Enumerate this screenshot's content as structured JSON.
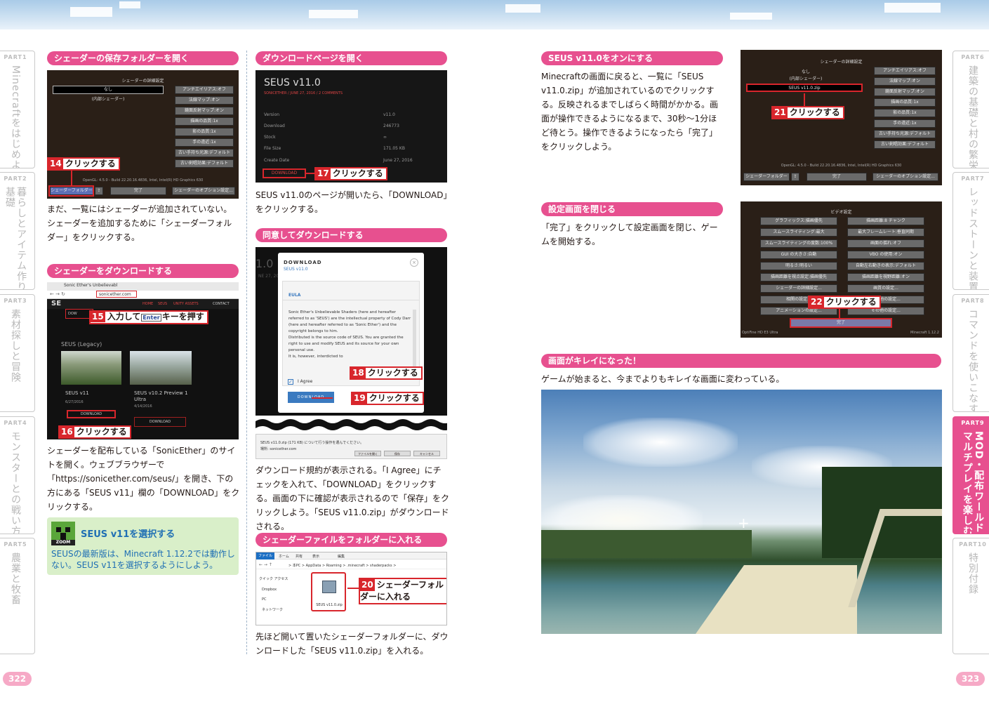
{
  "page_left": {
    "number": "322"
  },
  "page_right": {
    "number": "323"
  },
  "side_left": [
    {
      "part": "PART1",
      "title": "Minecraftをはじめよう"
    },
    {
      "part": "PART2",
      "title": "暮らしとアイテム作りの\n基礎"
    },
    {
      "part": "PART3",
      "title": "素材探しと冒険"
    },
    {
      "part": "PART4",
      "title": "モンスターとの戦い方"
    },
    {
      "part": "PART5",
      "title": "農業と牧畜"
    }
  ],
  "side_right": [
    {
      "part": "PART6",
      "title": "建築の基礎と村の繁栄"
    },
    {
      "part": "PART7",
      "title": "レッドストーンと装置"
    },
    {
      "part": "PART8",
      "title": "コマンドを使いこなす"
    },
    {
      "part": "PART9",
      "title": "MOD・配布ワールド・\nマルチプレイを楽しむ"
    },
    {
      "part": "PART10",
      "title": "特別付録"
    }
  ],
  "sec_open_folder": {
    "heading": "シェーダーの保存フォルダーを開く",
    "text": "まだ、一覧にはシェーダーが追加されていない。シェーダーを追加するために「シェーダーフォルダー」をクリックする。",
    "callout": {
      "num": "14",
      "label": "クリックする"
    },
    "mc": {
      "title": "シェーダーの詳細設定",
      "none": "なし",
      "internal": "(内部シェーダー)",
      "version": "OpenGL: 4.5.0 - Build 22.20.16.4836, Intel, Intel(R) HD Graphics 630",
      "btn_folder": "シェーダーフォルダー",
      "btn_done": "完了",
      "btn_options": "シェーダーのオプション設定...",
      "opts": [
        "アンチエイリアス:オフ",
        "法線マップ:オン",
        "鏡面反射マップ:オン",
        "描画の品質:1x",
        "影の品質:1x",
        "手の遠近:1x",
        "古い手持ち光源:デフォルト",
        "古い剣唱効果:デフォルト"
      ]
    }
  },
  "sec_download_seus": {
    "heading": "シェーダーをダウンロードする",
    "text": "シェーダーを配布している「SonicEther」のサイトを開く。ウェブブラウザーで「https://sonicether.com/seus/」を開き、下の方にある「SEUS v11」欄の「DOWNLOAD」をクリックする。",
    "callout15": {
      "num": "15",
      "pre": "入力して",
      "key": "Enter",
      "post": "キーを押す"
    },
    "callout16": {
      "num": "16",
      "label": "クリックする"
    },
    "browser": {
      "tab": "Sonic Ether's Unbelievabl",
      "url": "sonicether.com",
      "nav": [
        "HOME",
        "SEUS",
        "UNITY ASSETS",
        "CONTACT"
      ],
      "legacy": "SEUS (Legacy)",
      "card1_title": "SEUS v11",
      "card1_date": "6/27/2016",
      "card2_title": "SEUS v10.2 Preview 1 Ultra",
      "card2_date": "4/14/2016",
      "download": "DOWNLOAD"
    }
  },
  "zoom": {
    "badge": "ZOOM",
    "title": "SEUS v11を選択する",
    "text": "SEUSの最新版は、Minecraft 1.12.2では動作しない。SEUS v11を選択するようにしよう。"
  },
  "sec_open_page": {
    "heading": "ダウンロードページを開く",
    "text": "SEUS v11.0のページが開いたら、「DOWNLOAD」をクリックする。",
    "callout": {
      "num": "17",
      "label": "クリックする"
    },
    "page": {
      "title": "SEUS v11.0",
      "meta": "SONICETHER / JUNE 27, 2016 / 2 COMMENTS",
      "rows": [
        [
          "Version",
          "v11.0"
        ],
        [
          "Download",
          "246773"
        ],
        [
          "Stock",
          "∞"
        ],
        [
          "File Size",
          "171.05 KB"
        ],
        [
          "Create Date",
          "June 27, 2016"
        ]
      ],
      "download": "DOWNLOAD"
    }
  },
  "sec_agree": {
    "heading": "同意してダウンロードする",
    "text": "ダウンロード規約が表示される。「I Agree」にチェックを入れて、「DOWNLOAD」をクリックする。画面の下に確認が表示されるので「保存」をクリックしよう。「SEUS v11.0.zip」がダウンロードされる。",
    "callout18": {
      "num": "18",
      "label": "クリックする"
    },
    "callout19": {
      "num": "19",
      "label": "クリックする"
    },
    "dialog": {
      "title": "DOWNLOAD",
      "subtitle": "SEUS v11.0",
      "eula": "EULA",
      "body": "Sonic Ether's Unbelievable Shaders (here and hereafter referred to as 'SEUS') are the intellectual property of Cody Darr (here and hereafter referred to as 'Sonic Ether') and the copyright belongs to him.\nDistributed is the source code of SEUS. You are granted the right to use and modify SEUS and its source for your own personal use.\nIt is, however, interdicted to",
      "agree": "I Agree",
      "btn": "DOWNLOAD",
      "bg_text": "1.0",
      "bg_date": "NE 27, 20"
    },
    "bar": {
      "text": "SEUS v11.0.zip (171 KB) について行う操作を選んでください。",
      "from": "場所: sonicether.com",
      "open": "ファイルを開く",
      "save": "保存",
      "cancel": "キャンセル"
    }
  },
  "sec_put_folder": {
    "heading": "シェーダーファイルをフォルダーに入れる",
    "text": "先ほど開いて置いたシェーダーフォルダーに、ダウンロードした「SEUS v11.0.zip」を入れる。",
    "callout": {
      "num": "20",
      "label": "シェーダーフォル\nダーに入れる"
    },
    "explorer": {
      "ribbon": [
        "ファイル",
        "ホーム",
        "共有",
        "表示",
        "編集"
      ],
      "path": "> 本PC > AppData > Roaming > .minecraft > shaderpacks >",
      "nav": [
        "クイック アクセス",
        "Dropbox",
        "PC",
        "ネットワーク"
      ],
      "file": "SEUS v11.0.zip"
    }
  },
  "sec_turn_on": {
    "heading": "SEUS v11.0をオンにする",
    "text": "Minecraftの画面に戻ると、一覧に「SEUS v11.0.zip」が追加されているのでクリックする。反映されるまでしばらく時間がかかる。画面が操作できるようになるまで、30秒～1分ほど待とう。操作できるようになったら「完了」をクリックしよう。",
    "callout": {
      "num": "21",
      "label": "クリックする"
    },
    "mc": {
      "title": "シェーダーの詳細設定",
      "none": "なし",
      "internal": "(内部シェーダー)",
      "seus": "SEUS v11.0.zip",
      "version": "OpenGL: 4.5.0 - Build 22.20.16.4836, Intel, Intel(R) HD Graphics 630",
      "btn_folder": "シェーダーフォルダー",
      "btn_done": "完了",
      "btn_options": "シェーダーのオプション設定...",
      "opts": [
        "アンチエイリアス:オフ",
        "法線マップ:オン",
        "鏡面反射マップ:オン",
        "描画の品質:1x",
        "影の品質:1x",
        "手の遠近:1x",
        "古い手持ち光源:デフォルト",
        "古い剣唱効果:デフォルト"
      ]
    }
  },
  "sec_close": {
    "heading": "設定画面を閉じる",
    "text": "「完了」をクリックして設定画面を閉じ、ゲームを開始する。",
    "callout": {
      "num": "22",
      "label": "クリックする"
    },
    "mc": {
      "title": "ビデオ設定",
      "done": "完了",
      "footer_l": "OptiFine HD E3 Ultra",
      "footer_r": "Minecraft 1.12.2",
      "left": [
        "グラフィックス:描画優先",
        "スムースライティング:最大",
        "スムースライティングの度数:100%",
        "GUI の大きさ:自動",
        "明るさ:明るい",
        "描画距離を視点設定:描画優先",
        "シェーダーの詳細設定...",
        "相関の設定...",
        "アニメーションの設定..."
      ],
      "right": [
        "描画距離:8 チャンク",
        "最大フレームレート:垂直同期",
        "画面の揺れ:オフ",
        "VBO の使用:オン",
        "自動左右動きの表示:デフォルト",
        "描画距離を視野距離:オン",
        "画質の設定...",
        "その他の設定...",
        "その他の設定..."
      ]
    }
  },
  "sec_result": {
    "heading": "画面がキレイになった！",
    "text": "ゲームが始まると、今までよりもキレイな画面に変わっている。"
  }
}
